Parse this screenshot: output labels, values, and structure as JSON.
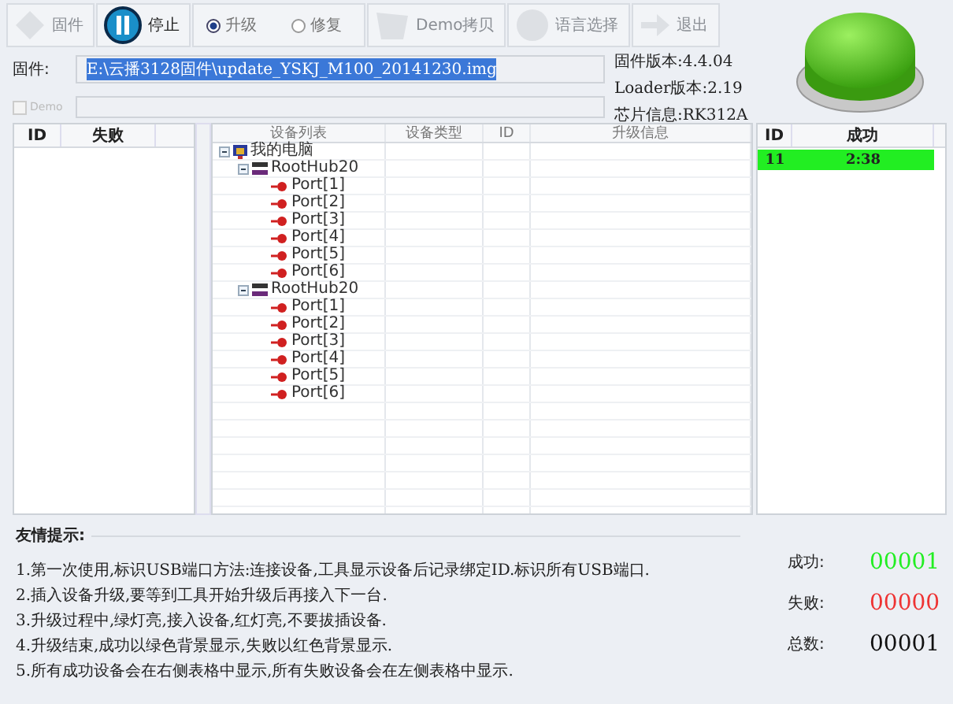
{
  "toolbar": [
    {
      "kind": "button",
      "label": "固件",
      "disabled": true
    },
    {
      "kind": "button",
      "label": "停止",
      "disabled": false
    },
    {
      "kind": "radios",
      "options": [
        {
          "label": "升级",
          "selected": true
        },
        {
          "label": "修复",
          "selected": false
        }
      ]
    },
    {
      "kind": "button",
      "label": "Demo拷贝",
      "disabled": true
    },
    {
      "kind": "button",
      "label": "语言选择",
      "disabled": true
    },
    {
      "kind": "button",
      "label": "退出",
      "disabled": true
    }
  ],
  "firmware": {
    "label": "固件:",
    "value": "E:\\云播3128固件\\update_YSKJ_M100_20141230.img"
  },
  "demo": {
    "label": "Demo",
    "checked": false,
    "disabled": true
  },
  "info": [
    "固件版本:4.4.04",
    "Loader版本:2.19",
    "芯片信息:RK312A"
  ],
  "status_light": {
    "on": true
  },
  "fail_table": {
    "columns": [
      "ID",
      "失败"
    ]
  },
  "device_table": {
    "columns": [
      "设备列表",
      "设备类型",
      "ID",
      "升级信息"
    ],
    "tree": [
      {
        "label": "我的电脑",
        "kind": "computer",
        "expanded": true,
        "children": [
          {
            "label": "RootHub20",
            "kind": "hub",
            "expanded": true,
            "children": [
              {
                "label": "Port[1]",
                "kind": "port"
              },
              {
                "label": "Port[2]",
                "kind": "port"
              },
              {
                "label": "Port[3]",
                "kind": "port"
              },
              {
                "label": "Port[4]",
                "kind": "port"
              },
              {
                "label": "Port[5]",
                "kind": "port"
              },
              {
                "label": "Port[6]",
                "kind": "port"
              }
            ]
          },
          {
            "label": "RootHub20",
            "kind": "hub",
            "expanded": true,
            "children": [
              {
                "label": "Port[1]",
                "kind": "port"
              },
              {
                "label": "Port[2]",
                "kind": "port"
              },
              {
                "label": "Port[3]",
                "kind": "port"
              },
              {
                "label": "Port[4]",
                "kind": "port"
              },
              {
                "label": "Port[5]",
                "kind": "port"
              },
              {
                "label": "Port[6]",
                "kind": "port"
              }
            ]
          }
        ]
      }
    ]
  },
  "success_table": {
    "columns": [
      "ID",
      "成功"
    ],
    "rows": [
      {
        "id": "11",
        "time": "2:38",
        "ok": true
      }
    ]
  },
  "tips": {
    "title": "友情提示:",
    "items": [
      "1.第一次使用,标识USB端口方法:连接设备,工具显示设备后记录绑定ID.标识所有USB端口.",
      "2.插入设备升级,要等到工具开始升级后再接入下一台.",
      "3.升级过程中,绿灯亮,接入设备,红灯亮,不要拔插设备.",
      "4.升级结束,成功以绿色背景显示,失败以红色背景显示.",
      "5.所有成功设备会在右侧表格中显示,所有失败设备会在左侧表格中显示."
    ]
  },
  "counters": [
    {
      "label": "成功:",
      "value": "00001",
      "kind": "success"
    },
    {
      "label": "失败:",
      "value": "00000",
      "kind": "fail"
    },
    {
      "label": "总数:",
      "value": "00001",
      "kind": "total"
    }
  ]
}
